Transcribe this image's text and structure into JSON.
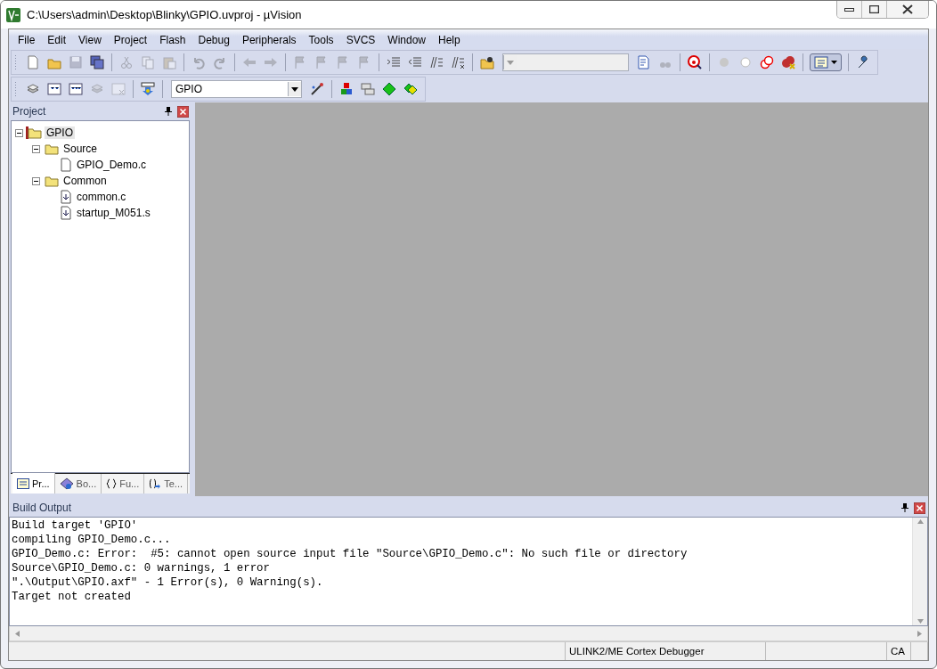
{
  "window": {
    "title": "C:\\Users\\admin\\Desktop\\Blinky\\GPIO.uvproj - µVision"
  },
  "menu": [
    "File",
    "Edit",
    "View",
    "Project",
    "Flash",
    "Debug",
    "Peripherals",
    "Tools",
    "SVCS",
    "Window",
    "Help"
  ],
  "toolbars": [
    {
      "items": [
        {
          "kind": "button",
          "disabled": false
        },
        {
          "kind": "button",
          "disabled": false
        },
        {
          "kind": "button",
          "disabled": true
        },
        {
          "kind": "button",
          "disabled": false
        },
        {
          "kind": "separator"
        },
        {
          "kind": "button",
          "disabled": true
        },
        {
          "kind": "button",
          "disabled": true
        },
        {
          "kind": "button",
          "disabled": true
        },
        {
          "kind": "separator"
        },
        {
          "kind": "button",
          "disabled": true
        },
        {
          "kind": "button",
          "disabled": true
        },
        {
          "kind": "separator"
        },
        {
          "kind": "button",
          "disabled": true
        },
        {
          "kind": "button",
          "disabled": true
        },
        {
          "kind": "separator"
        },
        {
          "kind": "button",
          "disabled": true
        },
        {
          "kind": "button",
          "disabled": true
        },
        {
          "kind": "button",
          "disabled": true
        },
        {
          "kind": "button",
          "disabled": true
        },
        {
          "kind": "separator"
        },
        {
          "kind": "button",
          "disabled": false
        },
        {
          "kind": "button",
          "disabled": false
        },
        {
          "kind": "button",
          "disabled": false
        },
        {
          "kind": "button",
          "disabled": false
        },
        {
          "kind": "separator"
        },
        {
          "kind": "button",
          "disabled": false
        },
        {
          "kind": "combo",
          "disabled": true
        },
        {
          "kind": "button",
          "disabled": false
        },
        {
          "kind": "button",
          "disabled": true
        },
        {
          "kind": "separator"
        },
        {
          "kind": "button",
          "disabled": false
        },
        {
          "kind": "separator"
        },
        {
          "kind": "button",
          "disabled": false
        },
        {
          "kind": "button",
          "disabled": false
        },
        {
          "kind": "button",
          "disabled": false
        },
        {
          "kind": "button",
          "disabled": false
        },
        {
          "kind": "separator"
        },
        {
          "kind": "menu-button",
          "disabled": false
        },
        {
          "kind": "separator"
        },
        {
          "kind": "button",
          "disabled": false
        }
      ]
    },
    {
      "items": [
        {
          "kind": "button",
          "disabled": false
        },
        {
          "kind": "button",
          "disabled": false
        },
        {
          "kind": "button",
          "disabled": false
        },
        {
          "kind": "button",
          "disabled": true
        },
        {
          "kind": "button",
          "disabled": true
        },
        {
          "kind": "separator"
        },
        {
          "kind": "button",
          "disabled": false
        },
        {
          "kind": "separator"
        },
        {
          "kind": "combo",
          "disabled": false,
          "value": "GPIO"
        },
        {
          "kind": "button",
          "disabled": false
        },
        {
          "kind": "separator"
        },
        {
          "kind": "button",
          "disabled": false
        },
        {
          "kind": "button",
          "disabled": false
        },
        {
          "kind": "button",
          "disabled": false
        },
        {
          "kind": "button",
          "disabled": false
        }
      ]
    }
  ],
  "project_panel": {
    "title": "Project",
    "tree": [
      {
        "label": "GPIO",
        "kind": "target",
        "expanded": true,
        "selected": true,
        "children": [
          {
            "label": "Source",
            "kind": "group",
            "expanded": true,
            "selected": false,
            "children": [
              {
                "label": "GPIO_Demo.c",
                "kind": "file",
                "selected": false
              }
            ]
          },
          {
            "label": "Common",
            "kind": "group",
            "expanded": true,
            "selected": false,
            "children": [
              {
                "label": "common.c",
                "kind": "lib",
                "selected": false
              },
              {
                "label": "startup_M051.s",
                "kind": "lib",
                "selected": false
              }
            ]
          }
        ]
      }
    ],
    "tabs": [
      {
        "label": "Pr...",
        "selected": true
      },
      {
        "label": "Bo...",
        "selected": false
      },
      {
        "label": "Fu...",
        "selected": false
      },
      {
        "label": "Te...",
        "selected": false
      }
    ]
  },
  "build_output": {
    "title": "Build Output",
    "lines": [
      "Build target 'GPIO'",
      "compiling GPIO_Demo.c...",
      "GPIO_Demo.c: Error:  #5: cannot open source input file \"Source\\GPIO_Demo.c\": No such file or directory",
      "Source\\GPIO_Demo.c: 0 warnings, 1 error",
      "\".\\Output\\GPIO.axf\" - 1 Error(s), 0 Warning(s).",
      "Target not created"
    ]
  },
  "status_bar": {
    "debugger": "ULINK2/ME Cortex Debugger",
    "caps": "CA"
  }
}
